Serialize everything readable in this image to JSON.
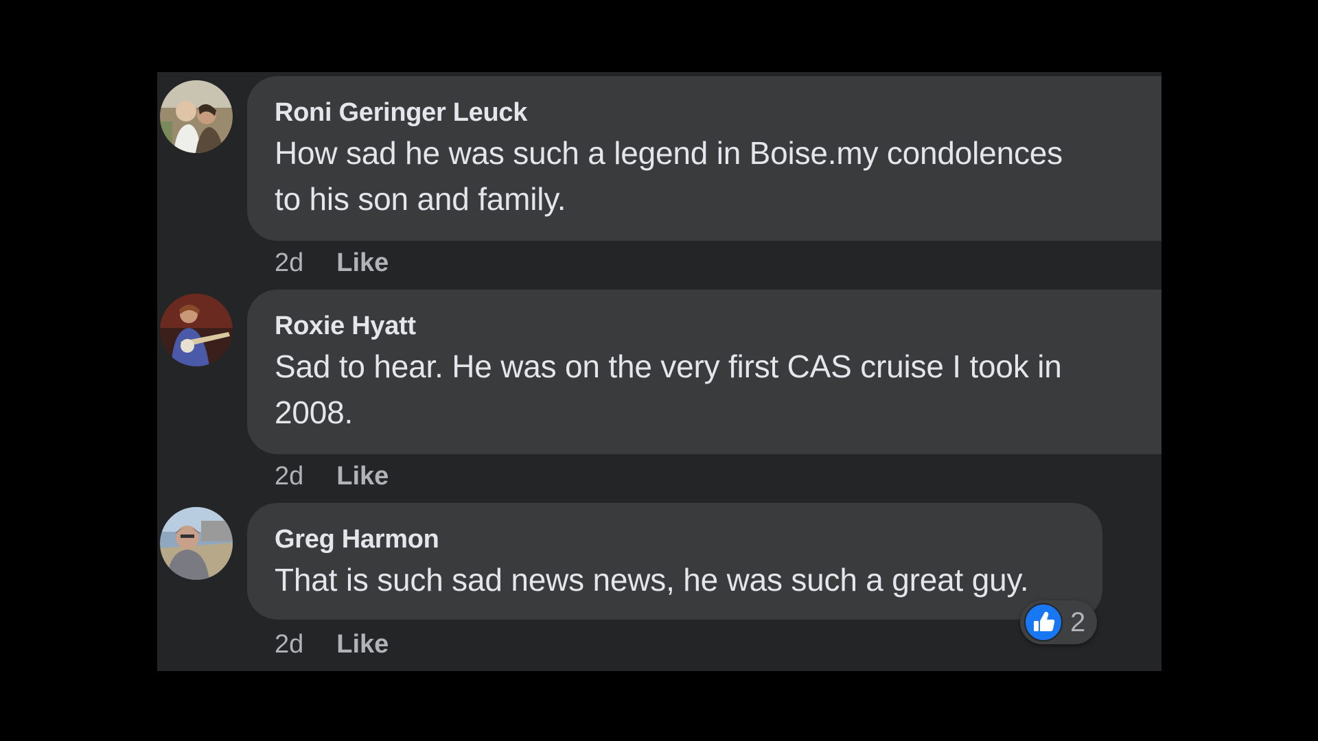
{
  "comments": [
    {
      "author": "Roni Geringer Leuck",
      "lines": [
        "How sad he was such a legend in Boise.my condolences",
        "to his son and family."
      ],
      "age": "2d",
      "like_label": "Like"
    },
    {
      "author": "Roxie Hyatt",
      "lines": [
        "Sad to hear. He was on the very first CAS cruise I took in",
        "2008."
      ],
      "age": "2d",
      "like_label": "Like"
    },
    {
      "author": "Greg Harmon",
      "lines": [
        "That is such sad news news, he was such a great guy."
      ],
      "age": "2d",
      "like_label": "Like",
      "reactions": {
        "icon": "thumbs-up-icon",
        "count": "2"
      }
    }
  ],
  "colors": {
    "background": "#000000",
    "panel": "#242526",
    "bubble": "#3a3b3c",
    "text": "#e4e6eb",
    "secondary_text": "#b0b3b8",
    "like_blue": "#1877f2"
  }
}
